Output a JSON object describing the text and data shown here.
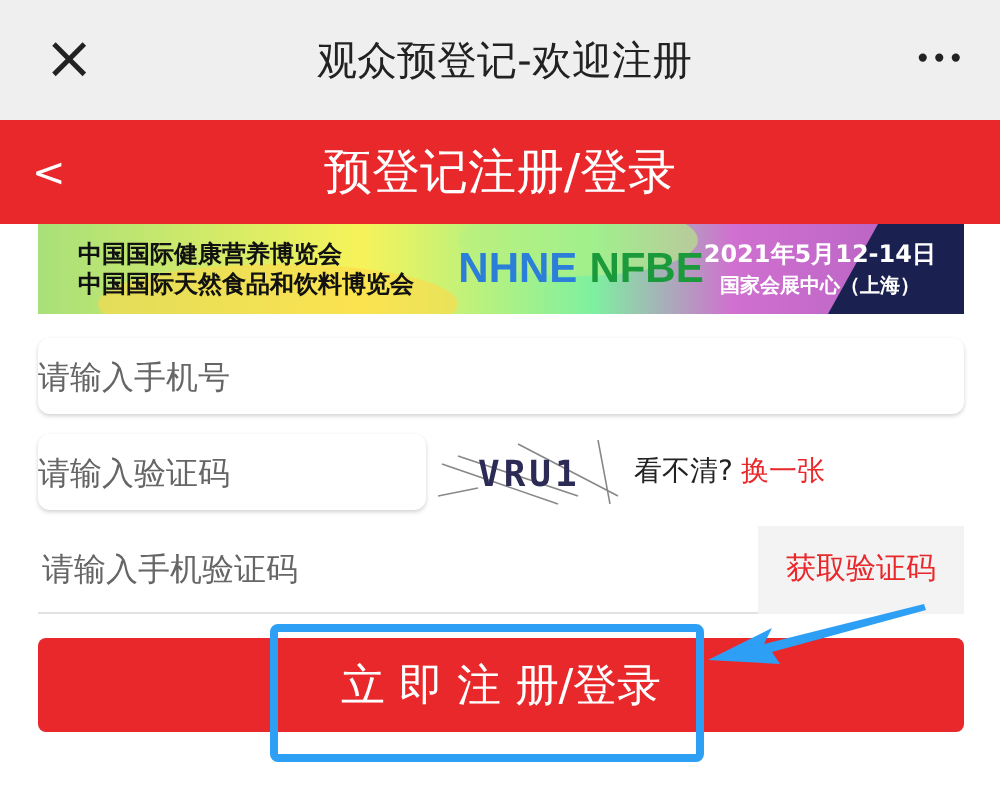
{
  "window": {
    "title": "观众预登记-欢迎注册",
    "close": "×",
    "more": "•••"
  },
  "header": {
    "back": "<",
    "title": "预登记注册/登录"
  },
  "banner": {
    "lines": [
      "中国国际健康营养博览会",
      "中国国际天然食品和饮料博览会"
    ],
    "logos": [
      "NHNE",
      "NFBE"
    ],
    "date": "2021年5月12-14日",
    "venue": "国家会展中心（上海）"
  },
  "form": {
    "phone": {
      "placeholder": "请输入手机号"
    },
    "captcha": {
      "placeholder": "请输入验证码",
      "code": "VRU1",
      "hint": "看不清?",
      "refresh": "换一张"
    },
    "sms": {
      "placeholder": "请输入手机验证码",
      "button": "获取验证码"
    },
    "submit": "立 即 注 册/登录"
  }
}
